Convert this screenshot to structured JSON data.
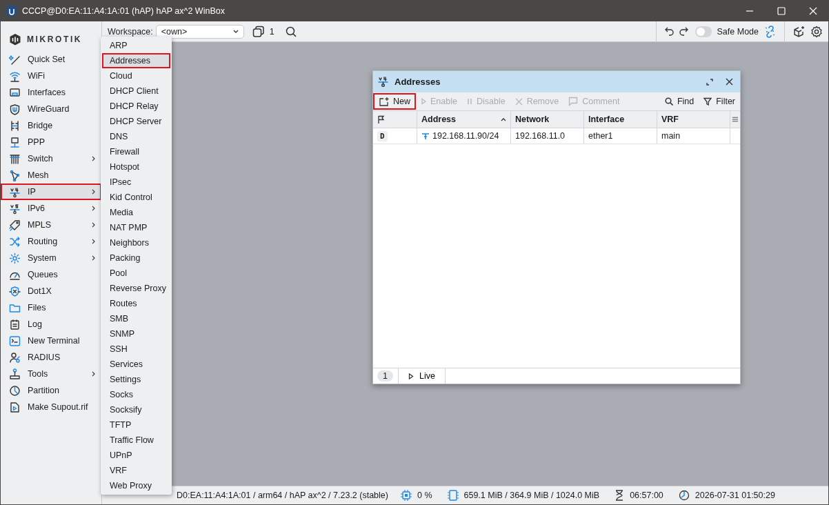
{
  "window": {
    "title": "CCCP@D0:EA:11:A4:1A:01 (hAP) hAP ax^2 WinBox"
  },
  "toolbar": {
    "workspace_label": "Workspace:",
    "workspace_value": "<own>",
    "window_count": "1",
    "safe_mode": {
      "label": "Safe Mode",
      "on": false
    }
  },
  "sidebar": {
    "logo": "MIKROTIK",
    "items": [
      {
        "label": "Quick Set",
        "has_submenu": false,
        "selected": false
      },
      {
        "label": "WiFi",
        "has_submenu": false,
        "selected": false
      },
      {
        "label": "Interfaces",
        "has_submenu": false,
        "selected": false
      },
      {
        "label": "WireGuard",
        "has_submenu": false,
        "selected": false
      },
      {
        "label": "Bridge",
        "has_submenu": false,
        "selected": false
      },
      {
        "label": "PPP",
        "has_submenu": false,
        "selected": false
      },
      {
        "label": "Switch",
        "has_submenu": true,
        "selected": false
      },
      {
        "label": "Mesh",
        "has_submenu": false,
        "selected": false
      },
      {
        "label": "IP",
        "has_submenu": true,
        "selected": true
      },
      {
        "label": "IPv6",
        "has_submenu": true,
        "selected": false
      },
      {
        "label": "MPLS",
        "has_submenu": true,
        "selected": false
      },
      {
        "label": "Routing",
        "has_submenu": true,
        "selected": false
      },
      {
        "label": "System",
        "has_submenu": true,
        "selected": false
      },
      {
        "label": "Queues",
        "has_submenu": false,
        "selected": false
      },
      {
        "label": "Dot1X",
        "has_submenu": false,
        "selected": false
      },
      {
        "label": "Files",
        "has_submenu": false,
        "selected": false
      },
      {
        "label": "Log",
        "has_submenu": false,
        "selected": false
      },
      {
        "label": "New Terminal",
        "has_submenu": false,
        "selected": false
      },
      {
        "label": "RADIUS",
        "has_submenu": false,
        "selected": false
      },
      {
        "label": "Tools",
        "has_submenu": true,
        "selected": false
      },
      {
        "label": "Partition",
        "has_submenu": false,
        "selected": false
      },
      {
        "label": "Make Supout.rif",
        "has_submenu": false,
        "selected": false
      }
    ]
  },
  "submenu": {
    "items": [
      {
        "label": "ARP",
        "selected": false
      },
      {
        "label": "Addresses",
        "selected": true
      },
      {
        "label": "Cloud",
        "selected": false
      },
      {
        "label": "DHCP Client",
        "selected": false
      },
      {
        "label": "DHCP Relay",
        "selected": false
      },
      {
        "label": "DHCP Server",
        "selected": false
      },
      {
        "label": "DNS",
        "selected": false
      },
      {
        "label": "Firewall",
        "selected": false
      },
      {
        "label": "Hotspot",
        "selected": false
      },
      {
        "label": "IPsec",
        "selected": false
      },
      {
        "label": "Kid Control",
        "selected": false
      },
      {
        "label": "Media",
        "selected": false
      },
      {
        "label": "NAT PMP",
        "selected": false
      },
      {
        "label": "Neighbors",
        "selected": false
      },
      {
        "label": "Packing",
        "selected": false
      },
      {
        "label": "Pool",
        "selected": false
      },
      {
        "label": "Reverse Proxy",
        "selected": false
      },
      {
        "label": "Routes",
        "selected": false
      },
      {
        "label": "SMB",
        "selected": false
      },
      {
        "label": "SNMP",
        "selected": false
      },
      {
        "label": "SSH",
        "selected": false
      },
      {
        "label": "Services",
        "selected": false
      },
      {
        "label": "Settings",
        "selected": false
      },
      {
        "label": "Socks",
        "selected": false
      },
      {
        "label": "Socksify",
        "selected": false
      },
      {
        "label": "TFTP",
        "selected": false
      },
      {
        "label": "Traffic Flow",
        "selected": false
      },
      {
        "label": "UPnP",
        "selected": false
      },
      {
        "label": "VRF",
        "selected": false
      },
      {
        "label": "Web Proxy",
        "selected": false
      }
    ]
  },
  "addresses_window": {
    "title": "Addresses",
    "buttons": [
      {
        "label": "New",
        "disabled": false,
        "highlighted": true
      },
      {
        "label": "Enable",
        "disabled": true,
        "highlighted": false
      },
      {
        "label": "Disable",
        "disabled": true,
        "highlighted": false
      },
      {
        "label": "Remove",
        "disabled": true,
        "highlighted": false
      },
      {
        "label": "Comment",
        "disabled": true,
        "highlighted": false
      },
      {
        "label": "Find",
        "disabled": false,
        "highlighted": false
      },
      {
        "label": "Filter",
        "disabled": false,
        "highlighted": false
      }
    ],
    "table": {
      "columns": [
        {
          "label": "Address",
          "sorted": true
        },
        {
          "label": "Network",
          "sorted": false
        },
        {
          "label": "Interface",
          "sorted": false
        },
        {
          "label": "VRF",
          "sorted": false
        }
      ],
      "rows": [
        {
          "flag": "D",
          "cells": [
            "192.168.11.90/24",
            "192.168.11.0",
            "ether1",
            "main"
          ]
        }
      ]
    },
    "footer": {
      "count": "1",
      "live_label": "Live"
    }
  },
  "status_bar": {
    "device": "D0:EA:11:A4:1A:01 / arm64 / hAP ax^2 / 7.23.2 (stable)",
    "cpu": "0 %",
    "memory": "659.1 MiB / 364.9 MiB / 1024.0 MiB",
    "uptime": "06:57:00",
    "clock": "2026-07-31 01:50:29"
  }
}
